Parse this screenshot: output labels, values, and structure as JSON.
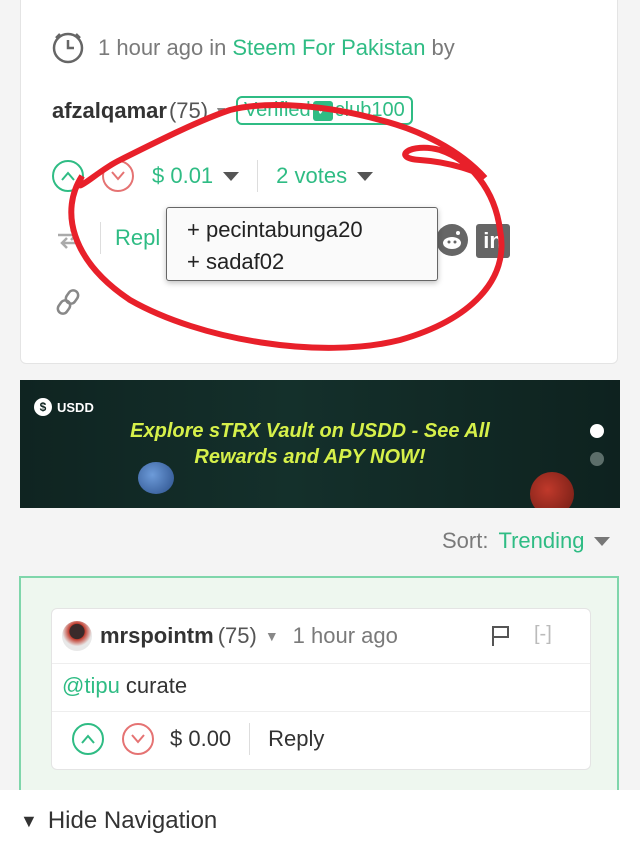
{
  "post": {
    "time": "1 hour ago",
    "in_word": "in",
    "community": "Steem For Pakistan",
    "by_word": "by",
    "author": "afzalqamar",
    "author_rep": "(75)",
    "badge_verified": "Verified",
    "badge_club": "club100",
    "payout": "$ 0.01",
    "votes_label": "2 votes",
    "reply_label": "Repl",
    "voters": [
      "+ pecintabunga20",
      "+ sadaf02"
    ]
  },
  "banner": {
    "brand": "USDD",
    "line1": "Explore sTRX Vault on USDD - See All",
    "line2": "Rewards and APY NOW!"
  },
  "sort": {
    "label": "Sort:",
    "value": "Trending"
  },
  "comment": {
    "author": "mrspointm",
    "author_rep": "(75)",
    "time": "1 hour ago",
    "collapse": "[-]",
    "mention": "@tipu",
    "text": " curate",
    "payout": "$ 0.00",
    "reply_label": "Reply"
  },
  "nav": {
    "arrow": "▼",
    "label": "Hide Navigation"
  },
  "colors": {
    "accent": "#2fbc84",
    "downvote": "#e57373",
    "annotation": "#e8202a",
    "banner_text": "#d6f04a"
  }
}
